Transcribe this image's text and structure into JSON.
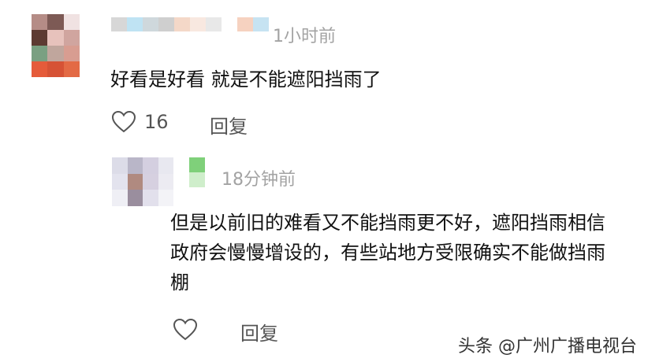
{
  "colors": {
    "avatar1": [
      "#b58c86",
      "#7d5a55",
      "#f0e2e2",
      "#5d3b32",
      "#e7c2bc",
      "#d0a59f",
      "#7aa082",
      "#c0a69d",
      "#d89d91",
      "#e55b3a",
      "#d65235",
      "#e36a45"
    ],
    "name1": [
      "#d7d7d7",
      "#bfe3f3",
      "#cfd8dc",
      "#cfcfcf",
      "#f4d8c8",
      "#f8e8e0",
      "#e8e8e8",
      "#ffffff",
      "#f6d2c0",
      "#c6e3f2"
    ],
    "avatar2": [
      "#dcdce8",
      "#b9b6c8",
      "#d4cfe0",
      "#e8e8f0",
      "#e3e3ee",
      "#b08a80",
      "#d6d0e0",
      "#ecebf2",
      "#efeff5",
      "#9a8e9e",
      "#e2e0ec",
      "#f3f3f7"
    ],
    "name2": [
      "#7fd07a",
      "#cfeecb"
    ],
    "heart": "#555555"
  },
  "comments": [
    {
      "time": "1小时前",
      "text": "好看是好看 就是不能遮阳挡雨了",
      "likes": "16",
      "reply_label": "回复"
    },
    {
      "time": "18分钟前",
      "text": "但是以前旧的难看又不能挡雨更不好，遮阳挡雨相信政府会慢慢增设的，有些站地方受限确实不能做挡雨棚",
      "reply_label": "回复"
    }
  ],
  "watermark": "头条 @广州广播电视台"
}
